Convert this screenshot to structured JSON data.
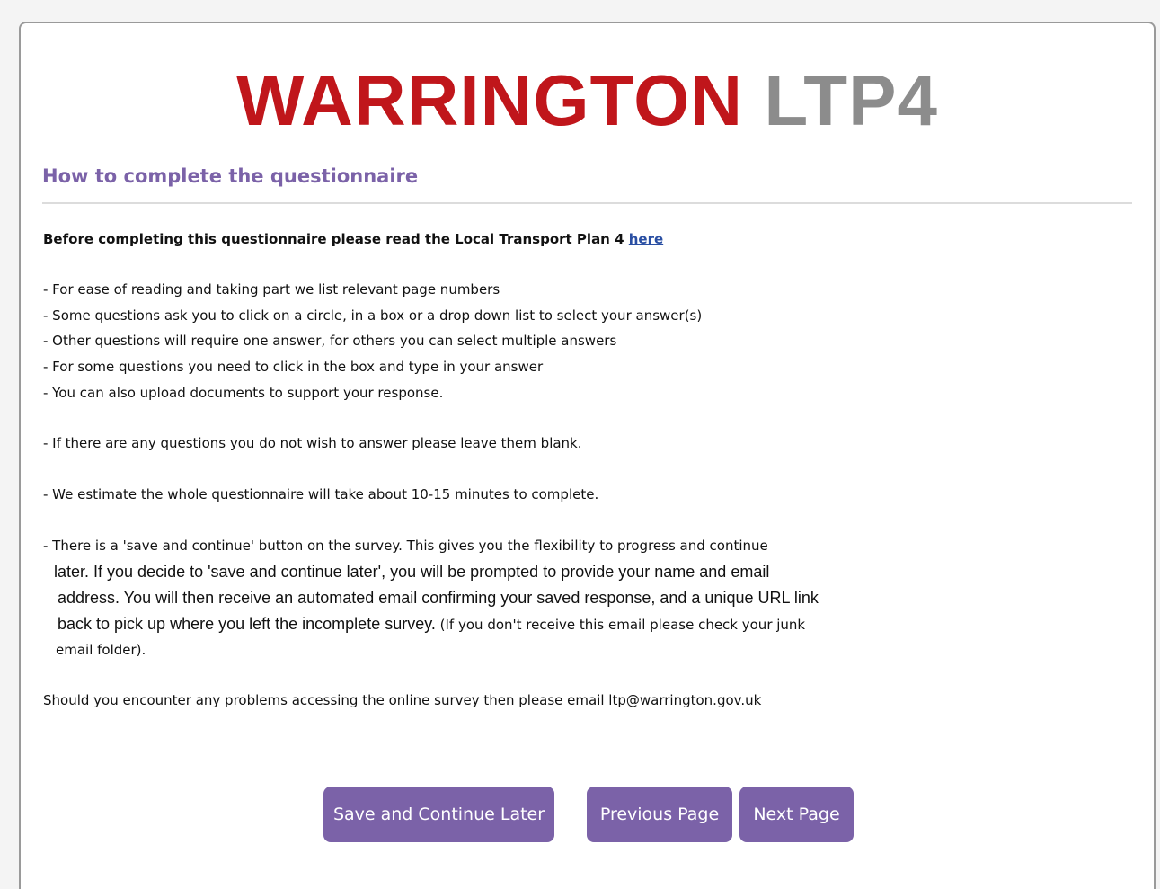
{
  "logo": {
    "main": "WARRINGTON",
    "suffix": "LTP4"
  },
  "heading": "How to complete the questionnaire",
  "intro": {
    "text": "Before completing this questionnaire please read the Local Transport Plan 4 ",
    "link": "here"
  },
  "bullets": [
    "- For ease of reading and taking part we list relevant page numbers",
    "- Some questions ask you to click on a circle, in a box or a drop down list to select your answer(s)",
    "- Other questions will require one answer, for others you can select multiple answers",
    "- For some questions you need to click in the box and type in your answer",
    "- You can also upload documents to support your response."
  ],
  "skip_note": "- If there are any questions you do not wish to answer please leave them blank.",
  "time_note": "- We estimate the whole questionnaire will take about 10-15 minutes to complete.",
  "save_note": {
    "line1": "- There is a 'save and continue' button on the survey. This gives you the flexibility to progress and continue",
    "line2": "later. If you decide to 'save and continue later', you will be prompted to provide your name and email",
    "line3": "address. You will then receive an automated email confirming your saved response, and a unique URL link",
    "line4": "back to pick up where you left the incomplete survey.",
    "line4b": " (If you don't receive this email please check your junk",
    "line5": "email folder)."
  },
  "contact_note": "Should you encounter any problems accessing the online survey then please email ltp@warrington.gov.uk",
  "buttons": {
    "save": "Save and Continue Later",
    "previous": "Previous Page",
    "next": "Next Page"
  },
  "colors": {
    "brand_red": "#c0161b",
    "brand_grey": "#8c8c8c",
    "accent_purple": "#7b62a8",
    "link": "#2a4fa3"
  }
}
